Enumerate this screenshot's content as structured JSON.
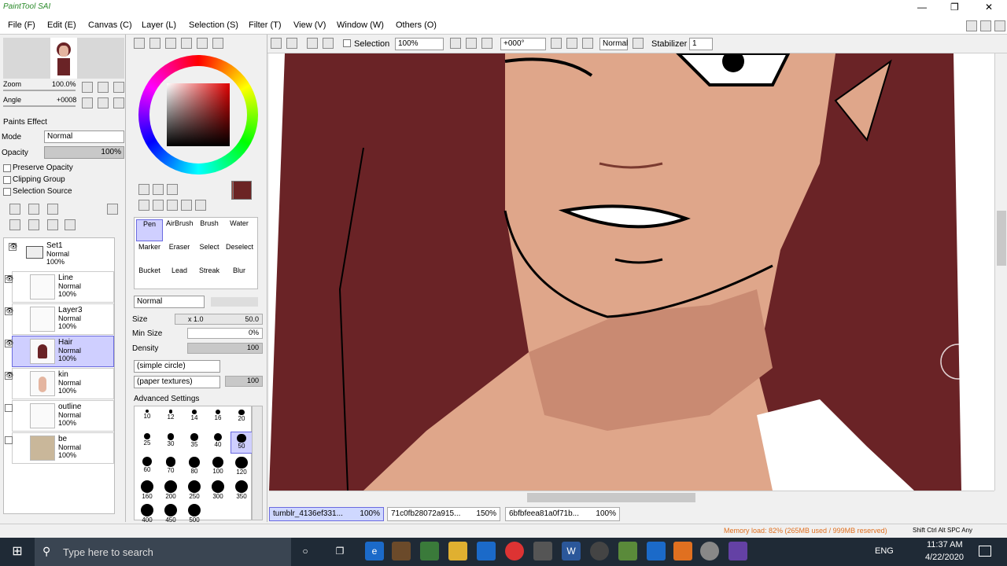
{
  "app": {
    "title": "PaintTool SAI",
    "window_controls": {
      "min": "—",
      "max": "❐",
      "close": "✕"
    }
  },
  "menu": [
    "File (F)",
    "Edit (E)",
    "Canvas (C)",
    "Layer (L)",
    "Selection (S)",
    "Filter (T)",
    "View (V)",
    "Window (W)",
    "Others (O)"
  ],
  "navigator": {
    "zoom_label": "Zoom",
    "zoom_value": "100.0%",
    "angle_label": "Angle",
    "angle_value": "+0008"
  },
  "layer_panel": {
    "paints_effect": "Paints Effect",
    "mode_label": "Mode",
    "mode_value": "Normal",
    "opacity_label": "Opacity",
    "opacity_value": "100%",
    "preserve_opacity": "Preserve Opacity",
    "clipping_group": "Clipping Group",
    "selection_source": "Selection Source",
    "layers": [
      {
        "name": "Set1",
        "mode": "Normal",
        "opacity": "100%"
      },
      {
        "name": "Line",
        "mode": "Normal",
        "opacity": "100%"
      },
      {
        "name": "Layer3",
        "mode": "Normal",
        "opacity": "100%"
      },
      {
        "name": "Hair",
        "mode": "Normal",
        "opacity": "100%"
      },
      {
        "name": "kin",
        "mode": "Normal",
        "opacity": "100%"
      },
      {
        "name": "outline",
        "mode": "Normal",
        "opacity": "100%"
      },
      {
        "name": "be",
        "mode": "Normal",
        "opacity": "100%"
      }
    ]
  },
  "tools": {
    "row1": [
      "Pen",
      "AirBrush",
      "Brush",
      "Water"
    ],
    "row2": [
      "Marker",
      "Eraser",
      "Select",
      "Deselect"
    ],
    "row3": [
      "Bucket",
      "Lead",
      "Streak",
      "Blur"
    ]
  },
  "brush_settings": {
    "mode": "Normal",
    "size_label": "Size",
    "size_mult": "x 1.0",
    "size_value": "50.0",
    "minsize_label": "Min Size",
    "minsize_value": "0%",
    "density_label": "Density",
    "density_value": "100",
    "shape": "(simple circle)",
    "texture": "(paper textures)",
    "texture_value": "100",
    "advanced": "Advanced Settings",
    "sizes": [
      "10",
      "12",
      "14",
      "16",
      "20",
      "25",
      "30",
      "35",
      "40",
      "50",
      "60",
      "70",
      "80",
      "100",
      "120",
      "160",
      "200",
      "250",
      "300",
      "350",
      "400",
      "450",
      "500"
    ]
  },
  "toolbar": {
    "selection_label": "Selection",
    "zoom": "100%",
    "angle": "+000°",
    "blend": "Normal",
    "stabilizer_label": "Stabilizer",
    "stabilizer_value": "1"
  },
  "tabs": [
    {
      "name": "tumblr_4136ef331...",
      "zoom": "100%"
    },
    {
      "name": "71c0fb28072a915...",
      "zoom": "150%"
    },
    {
      "name": "6bfbfeea81a0f71b...",
      "zoom": "100%"
    }
  ],
  "status": {
    "memory": "Memory load: 82% (265MB used / 999MB reserved)",
    "keys": "Shift Ctrl Alt SPC  Any"
  },
  "taskbar": {
    "search_placeholder": "Type here to search",
    "time": "11:37 AM",
    "date": "4/22/2020",
    "lang": "ENG"
  },
  "colors": {
    "primary": "#6b2424",
    "secondary": "#a0463c",
    "hair": "#6a2326",
    "skin": "#dfa68a"
  }
}
